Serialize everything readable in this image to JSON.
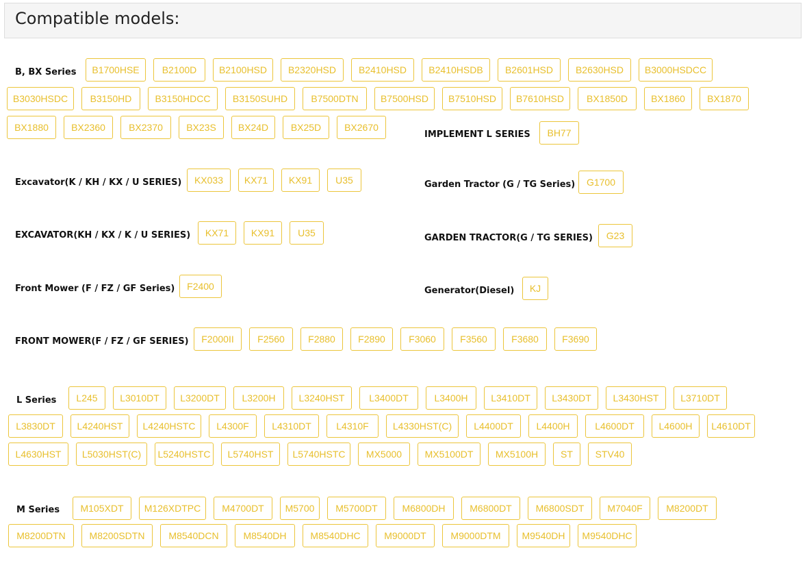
{
  "header": {
    "title": "Compatible models:"
  },
  "groups": [
    {
      "name": "B, BX Series",
      "models": [
        "B1700HSE",
        "B2100D",
        "B2100HSD",
        "B2320HSD",
        "B2410HSD",
        "B2410HSDB",
        "B2601HSD",
        "B2630HSD",
        "B3000HSDCC",
        "B3030HSDC",
        "B3150HD",
        "B3150HDCC",
        "B3150SUHD",
        "B7500DTN",
        "B7500HSD",
        "B7510HSD",
        "B7610HSD",
        "BX1850D",
        "BX1860",
        "BX1870",
        "BX1880",
        "BX2360",
        "BX2370",
        "BX23S",
        "BX24D",
        "BX25D",
        "BX2670"
      ]
    },
    {
      "name": "IMPLEMENT L SERIES",
      "models": [
        "BH77"
      ]
    },
    {
      "name": "Excavator(K / KH / KX / U SERIES)",
      "models": [
        "KX033",
        "KX71",
        "KX91",
        "U35"
      ]
    },
    {
      "name": "Garden Tractor (G / TG Series)",
      "models": [
        "G1700"
      ]
    },
    {
      "name": "EXCAVATOR(KH / KX / K / U SERIES)",
      "models": [
        "KX71",
        "KX91",
        "U35"
      ]
    },
    {
      "name": "GARDEN TRACTOR(G / TG SERIES)",
      "models": [
        "G23"
      ]
    },
    {
      "name": "Front Mower (F / FZ / GF Series)",
      "models": [
        "F2400"
      ]
    },
    {
      "name": "Generator(Diesel)",
      "models": [
        "KJ"
      ]
    },
    {
      "name": "FRONT MOWER(F / FZ / GF SERIES)",
      "models": [
        "F2000II",
        "F2560",
        "F2880",
        "F2890",
        "F3060",
        "F3560",
        "F3680",
        "F3690"
      ]
    },
    {
      "name": "L Series",
      "models": [
        "L245",
        "L3010DT",
        "L3200DT",
        "L3200H",
        "L3240HST",
        "L3400DT",
        "L3400H",
        "L3410DT",
        "L3430DT",
        "L3430HST",
        "L3710DT",
        "L3830DT",
        "L4240HST",
        "L4240HSTC",
        "L4300F",
        "L4310DT",
        "L4310F",
        "L4330HST(C)",
        "L4400DT",
        "L4400H",
        "L4600DT",
        "L4600H",
        "L4610DT",
        "L4630HST",
        "L5030HST(C)",
        "L5240HSTC",
        "L5740HST",
        "L5740HSTC",
        "MX5000",
        "MX5100DT",
        "MX5100H",
        "ST",
        "STV40"
      ]
    },
    {
      "name": "M Series",
      "models": [
        "M105XDT",
        "M126XDTPC",
        "M4700DT",
        "M5700",
        "M5700DT",
        "M6800DH",
        "M6800DT",
        "M6800SDT",
        "M7040F",
        "M8200DT",
        "M8200DTN",
        "M8200SDTN",
        "M8540DCN",
        "M8540DH",
        "M8540DHC",
        "M9000DT",
        "M9000DTM",
        "M9540DH",
        "M9540DHC"
      ]
    }
  ]
}
